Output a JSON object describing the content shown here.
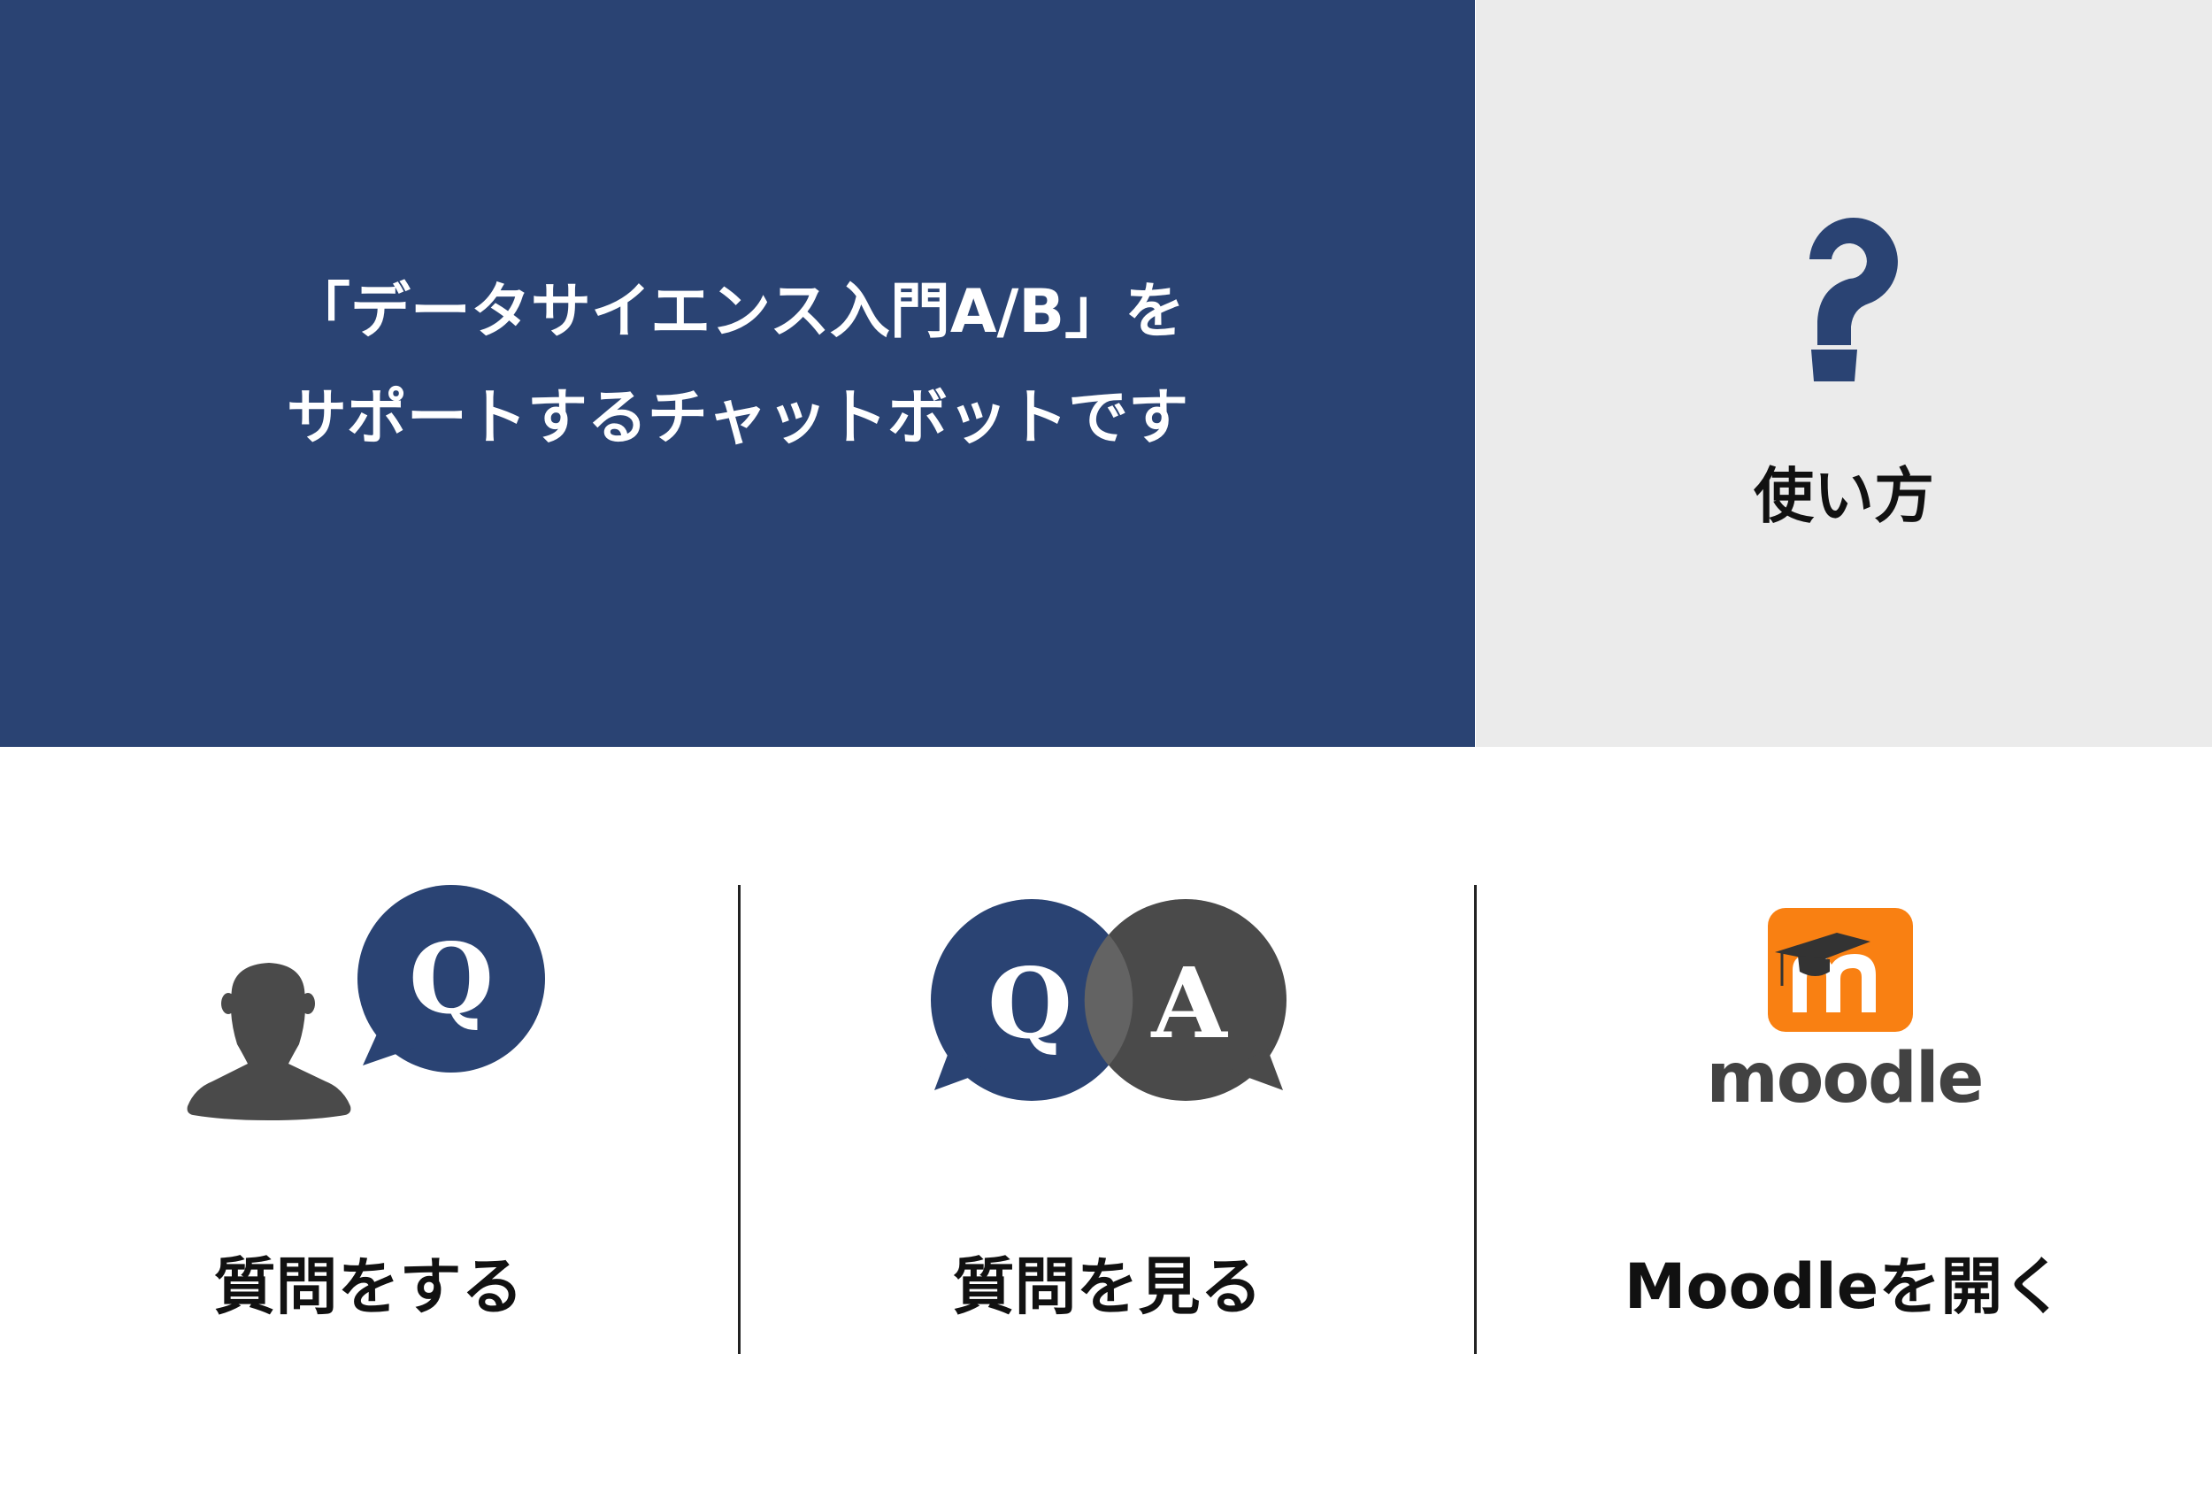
{
  "intro": {
    "line1": "「データサイエンス入門A/B」を",
    "line2": "サポートするチャットボットです"
  },
  "howto": {
    "label": "使い方",
    "icon": "question-mark-icon"
  },
  "actions": [
    {
      "label": "質問をする",
      "icon": "person-question-bubble-icon",
      "glyph": "Q"
    },
    {
      "label": "質問を見る",
      "icon": "question-answer-bubbles-icon",
      "glyph_q": "Q",
      "glyph_a": "A"
    },
    {
      "label": "Moodleを開く",
      "icon": "moodle-logo-icon",
      "logo_text": "moodle"
    }
  ],
  "colors": {
    "navy": "#2a4373",
    "light_gray": "#ebebeb",
    "dark_gray": "#4a4a4a",
    "moodle_orange": "#f98012"
  }
}
